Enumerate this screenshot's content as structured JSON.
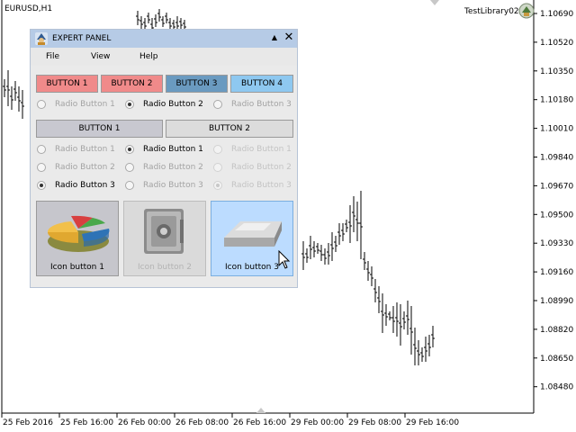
{
  "chart": {
    "symbol_label": "EURUSD,H1",
    "expert_label": "TestLibrary02",
    "price_labels": [
      "1.10690",
      "1.10520",
      "1.10350",
      "1.10180",
      "1.10010",
      "1.09840",
      "1.09670",
      "1.09500",
      "1.09330",
      "1.09160",
      "1.08990",
      "1.08820",
      "1.08650",
      "1.08480"
    ],
    "time_labels": [
      "25 Feb 2016",
      "25 Feb 16:00",
      "26 Feb 00:00",
      "26 Feb 08:00",
      "26 Feb 16:00",
      "29 Feb 00:00",
      "29 Feb 08:00",
      "29 Feb 16:00"
    ],
    "bar_color": "#000000"
  },
  "panel": {
    "title": "EXPERT PANEL",
    "titlebar_color": "#b6cbe6",
    "minimize_icon": "▲",
    "close_icon": "✕",
    "menu": [
      "File",
      "View",
      "Help"
    ],
    "color_buttons": [
      {
        "label": "BUTTON 1",
        "color": "#f08a8a"
      },
      {
        "label": "BUTTON 2",
        "color": "#f08a8a"
      },
      {
        "label": "BUTTON 3",
        "color": "#6a9ac0"
      },
      {
        "label": "BUTTON 4",
        "color": "#8ec8f0"
      }
    ],
    "radio_row_top": [
      {
        "label": "Radio Button 1",
        "checked": false
      },
      {
        "label": "Radio Button 2",
        "checked": true
      },
      {
        "label": "Radio Button 3",
        "checked": false
      }
    ],
    "toggle_buttons": [
      "BUTTON 1",
      "BUTTON 2"
    ],
    "radio_grid": [
      [
        "Radio Button 1",
        "Radio Button 1",
        "Radio Button 1"
      ],
      [
        "Radio Button 2",
        "Radio Button 2",
        "Radio Button 2"
      ],
      [
        "Radio Button 3",
        "Radio Button 3",
        "Radio Button 3"
      ]
    ],
    "icon_buttons": [
      {
        "label": "Icon button 1",
        "icon": "pie-chart-icon"
      },
      {
        "label": "Icon button 2",
        "icon": "safe-icon"
      },
      {
        "label": "Icon button 3",
        "icon": "silver-bar-icon"
      }
    ]
  }
}
